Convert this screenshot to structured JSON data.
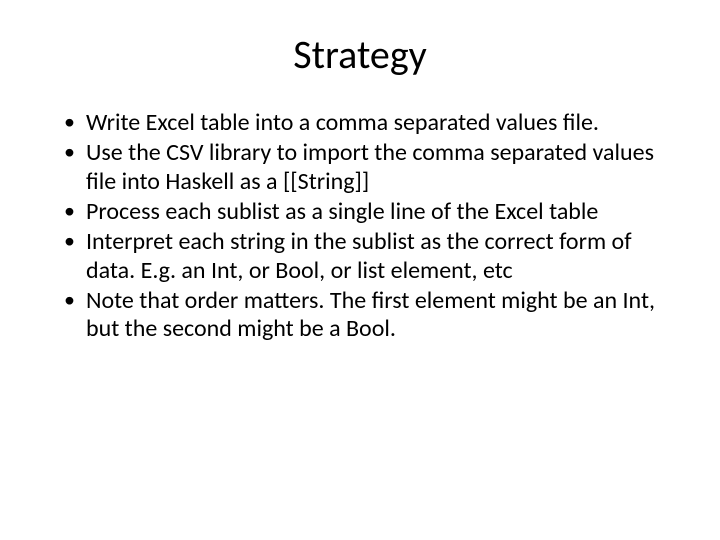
{
  "title": "Strategy",
  "bullets": [
    "Write Excel table into a comma separated values file.",
    "Use the CSV library to import the comma separated values file into Haskell as a [[String]]",
    "Process each sublist as a single line of the Excel table",
    "Interpret each string in the sublist as the correct form of data.  E.g. an Int, or Bool, or list element, etc",
    "Note that order matters. The first element might be an Int, but the second might be a Bool."
  ]
}
